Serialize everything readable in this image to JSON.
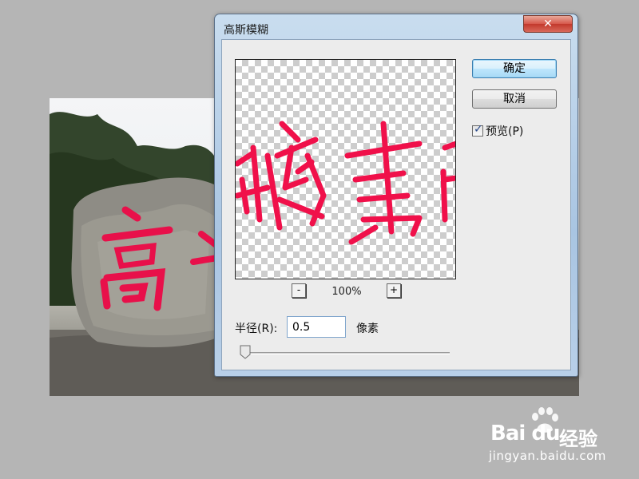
{
  "dialog": {
    "title": "高斯模糊",
    "close_label": "✕",
    "ok_label": "确定",
    "cancel_label": "取消",
    "preview_checkbox_label": "预览(P)",
    "preview_checked": true,
    "zoom": {
      "minus_label": "-",
      "value": "100%",
      "plus_label": "+"
    },
    "radius": {
      "label": "半径(R):",
      "value": "0.5",
      "unit": "像素",
      "slider_fraction": 0.0
    }
  },
  "canvas": {
    "stone_text": "高的"
  },
  "watermark": {
    "brand": "Bai du",
    "product": "经验",
    "url": "jingyan.baidu.com"
  },
  "colors": {
    "calligraphy": "#f0104a",
    "dialog_frame": "#a9c5e2",
    "ok_button": "#bee6fd",
    "close_button": "#c2392c"
  }
}
